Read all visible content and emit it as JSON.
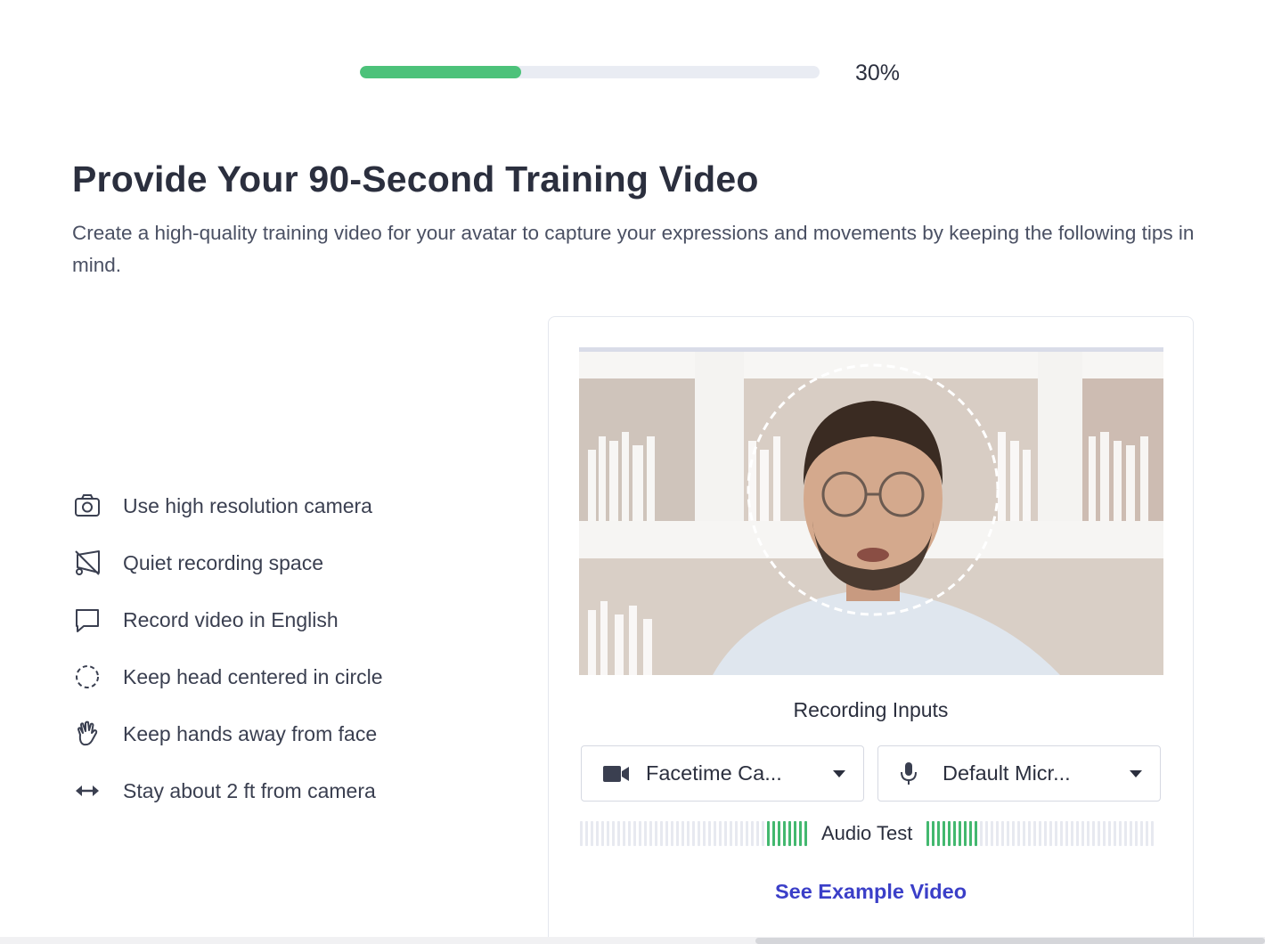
{
  "progress": {
    "percent_label": "30%",
    "fraction": 0.35,
    "fill_color": "#4cc27a"
  },
  "header": {
    "title": "Provide Your 90-Second Training Video",
    "subtitle": "Create a high-quality training video for your avatar to capture your expressions and movements by keeping the following tips in mind."
  },
  "tips": [
    {
      "icon": "camera-icon",
      "label": "Use high resolution camera"
    },
    {
      "icon": "muted-speaker-icon",
      "label": "Quiet recording space"
    },
    {
      "icon": "speech-bubble-icon",
      "label": "Record video in English"
    },
    {
      "icon": "dashed-circle-icon",
      "label": "Keep head centered in circle"
    },
    {
      "icon": "hand-icon",
      "label": "Keep hands away from face"
    },
    {
      "icon": "horizontal-arrows-icon",
      "label": "Stay about 2 ft from camera"
    }
  ],
  "recording": {
    "title": "Recording Inputs",
    "camera_select": {
      "icon": "video-camera-icon",
      "value": "Facetime Ca..."
    },
    "mic_select": {
      "icon": "microphone-icon",
      "value": "Default Micr..."
    },
    "audio_test_label": "Audio Test",
    "meter_active_color": "#43b86f",
    "example_link": "See Example Video"
  }
}
